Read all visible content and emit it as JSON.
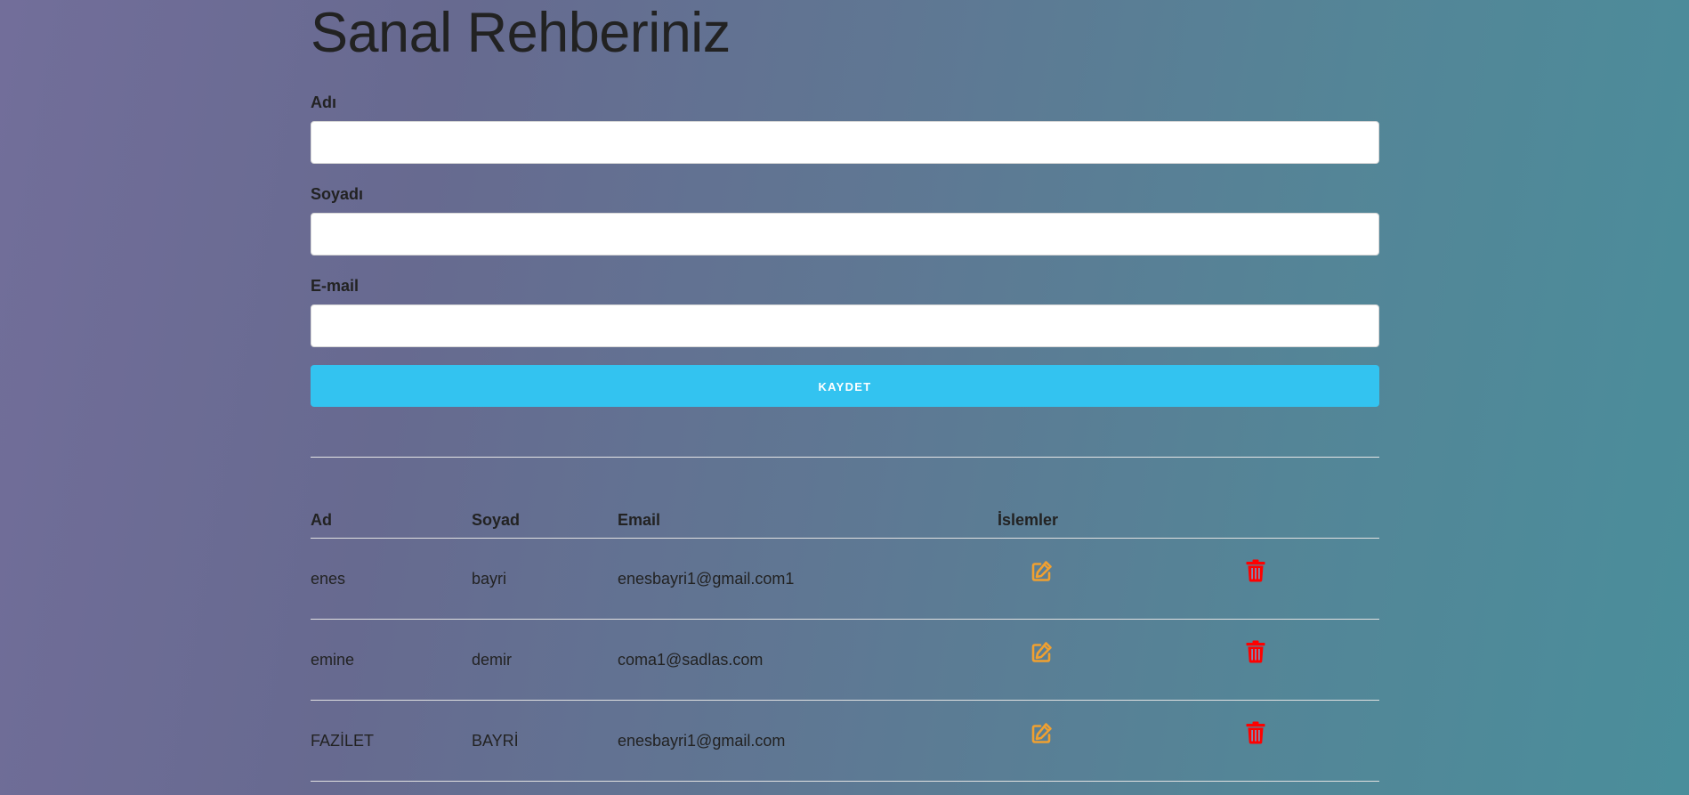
{
  "page": {
    "title": "Sanal Rehberiniz"
  },
  "form": {
    "first_name_label": "Adı",
    "last_name_label": "Soyadı",
    "email_label": "E-mail",
    "first_name_value": "",
    "last_name_value": "",
    "email_value": "",
    "save_button_label": "KAYDET"
  },
  "table": {
    "headers": [
      "Ad",
      "Soyad",
      "Email",
      "İslemler"
    ],
    "rows": [
      {
        "ad": "enes",
        "soyad": "bayri",
        "email": "enesbayri1@gmail.com1"
      },
      {
        "ad": "emine",
        "soyad": "demir",
        "email": "coma1@sadlas.com"
      },
      {
        "ad": "FAZİLET",
        "soyad": "BAYRİ",
        "email": "enesbayri1@gmail.com"
      }
    ]
  },
  "icons": {
    "edit": "edit-icon",
    "delete": "trash-icon"
  },
  "colors": {
    "accent": "#33c3f0",
    "edit_icon": "#f0a030",
    "delete_icon": "#ff0000"
  }
}
